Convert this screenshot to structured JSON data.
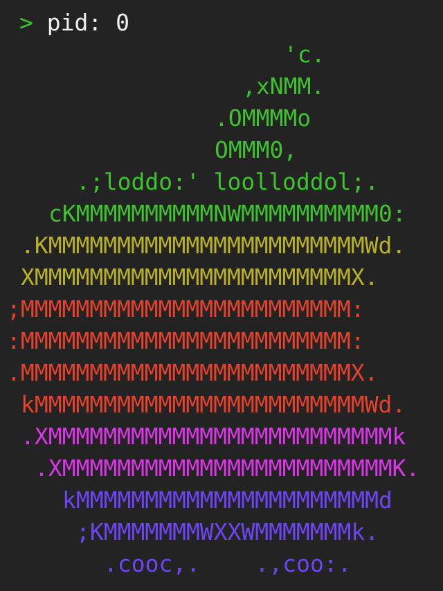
{
  "prompt": {
    "arrow": ">",
    "text": "pid: 0"
  },
  "colors": {
    "background": "#232323",
    "green": "#3fc22f",
    "yellow": "#b8b128",
    "red": "#e3422d",
    "magenta": "#d937e6",
    "purple": "#6d45f2",
    "white": "#f0f0f0"
  },
  "logo": {
    "lines": [
      "'c.",
      ",xNMM.",
      ".OMMMMo",
      "OMMM0,",
      ".;loddo:' loolloddol;.",
      "cKMMMMMMMMMMNWMMMMMMMMMM0:",
      ".KMMMMMMMMMMMMMMMMMMMMMMMWd.",
      "XMMMMMMMMMMMMMMMMMMMMMMMX.",
      ";MMMMMMMMMMMMMMMMMMMMMMMM:",
      ":MMMMMMMMMMMMMMMMMMMMMMMM:",
      ".MMMMMMMMMMMMMMMMMMMMMMMMX.",
      "kMMMMMMMMMMMMMMMMMMMMMMMMWd.",
      ".XMMMMMMMMMMMMMMMMMMMMMMMMMk",
      ".XMMMMMMMMMMMMMMMMMMMMMMMMK.",
      "kMMMMMMMMMMMMMMMMMMMMMMd",
      ";KMMMMMMMWXXWMMMMMMMk.",
      ".cooc,.    .,coo:."
    ]
  }
}
